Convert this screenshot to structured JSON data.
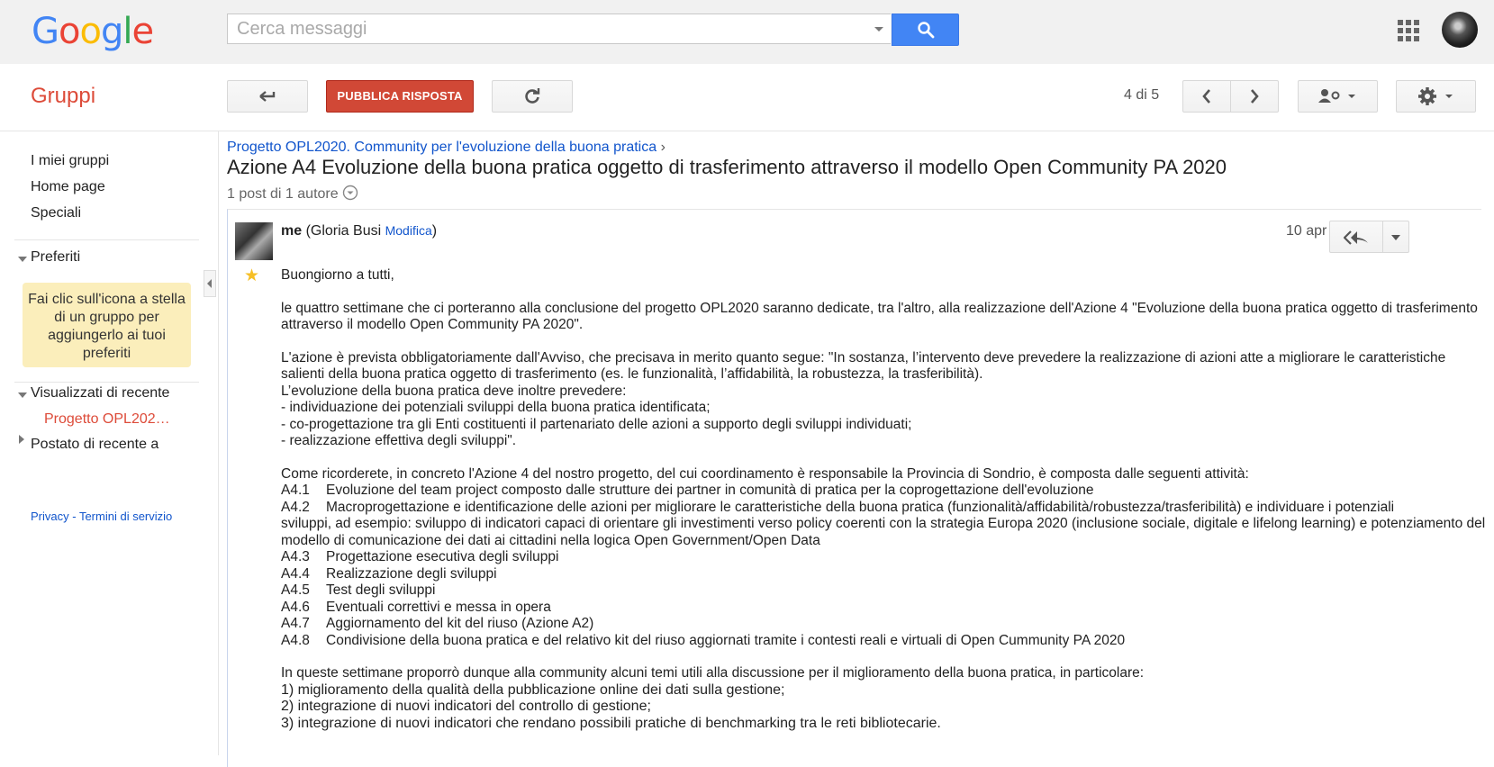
{
  "header": {
    "logo": {
      "letters": [
        "G",
        "o",
        "o",
        "g",
        "l",
        "e"
      ],
      "colors": [
        "#4285f4",
        "#ea4335",
        "#fbbc05",
        "#4285f4",
        "#34a853",
        "#ea4335"
      ]
    },
    "search": {
      "placeholder": "Cerca messaggi",
      "value": ""
    },
    "icons": {
      "search": "search-icon",
      "apps": "apps-grid-icon",
      "account": "account-avatar"
    }
  },
  "toolbar": {
    "app_name": "Gruppi",
    "back_icon": "back-arrow-icon",
    "publish_label": "PUBBLICA RISPOSTA",
    "refresh_icon": "refresh-icon",
    "position": "4 di 5",
    "prev_icon": "chevron-left-icon",
    "next_icon": "chevron-right-icon",
    "members_icon": "manage-members-icon",
    "settings_icon": "gear-icon",
    "accent_color": "#d14836"
  },
  "sidebar": {
    "links": [
      "I miei gruppi",
      "Home page",
      "Speciali"
    ],
    "favorites_label": "Preferiti",
    "favorites_hint": "Fai clic sull'icona a stella di un gruppo per aggiungerlo ai tuoi preferiti",
    "recent_label": "Visualizzati di recente",
    "recent_item": "Progetto OPL202…",
    "posted_label": "Postato di recente a",
    "footer_privacy": "Privacy",
    "footer_sep": " - ",
    "footer_terms": "Termini di servizio"
  },
  "thread": {
    "breadcrumb": "Progetto OPL2020. Community per l'evoluzione della buona pratica",
    "breadcrumb_sep": "›",
    "title": "Azione A4 Evoluzione della buona pratica oggetto di trasferimento attraverso il modello Open Community PA 2020",
    "meta": "1 post di 1 autore"
  },
  "post": {
    "author_me": "me",
    "author_name_open": " (Gloria Busi ",
    "edit_label": "Modifica",
    "author_close": ")",
    "date": "10 apr",
    "greeting": "Buongiorno a tutti,",
    "p1": "le quattro settimane che ci porteranno alla conclusione del progetto OPL2020 saranno dedicate, tra l'altro, alla realizzazione dell'Azione 4 \"Evoluzione della buona pratica oggetto di trasferimento attraverso il modello Open Community PA 2020\".",
    "p2": "L'azione è prevista obbligatoriamente dall'Avviso, che precisava in merito quanto segue: \"In sostanza, l’intervento deve prevedere la realizzazione di azioni atte a migliorare le caratteristiche salienti della buona pratica oggetto di trasferimento (es. le funzionalità, l’affidabilità, la robustezza, la trasferibilità).",
    "p2_lines": [
      "L’evoluzione della buona pratica deve inoltre prevedere:",
      "- individuazione dei potenziali sviluppi della buona pratica identificata;",
      "- co-progettazione tra gli Enti costituenti il partenariato delle azioni a supporto degli sviluppi individuati;",
      "- realizzazione effettiva degli sviluppi\"."
    ],
    "p3_intro": "Come ricorderete, in concreto l'Azione 4 del nostro progetto, del cui coordinamento è responsabile la Provincia di Sondrio, è composta dalle seguenti attività:",
    "activities": [
      {
        "code": "A4.1",
        "text": "Evoluzione del team project composto dalle strutture dei partner in comunità di pratica per la coprogettazione dell'evoluzione"
      },
      {
        "code": "A4.2",
        "text": "Macroprogettazione e identificazione delle azioni per migliorare le caratteristiche della buona pratica (funzionalità/affidabilità/robustezza/trasferibilità) e individuare i potenziali"
      },
      {
        "code": "",
        "text": "sviluppi, ad esempio: sviluppo di indicatori capaci di orientare gli investimenti verso policy coerenti con la strategia Europa 2020 (inclusione sociale, digitale e lifelong learning) e potenziamento del modello di comunicazione dei dati ai cittadini nella logica Open Government/Open Data"
      },
      {
        "code": "A4.3",
        "text": "Progettazione esecutiva degli sviluppi"
      },
      {
        "code": "A4.4",
        "text": "Realizzazione degli sviluppi"
      },
      {
        "code": "A4.5",
        "text": "Test degli sviluppi"
      },
      {
        "code": "A4.6",
        "text": "Eventuali correttivi e messa in opera"
      },
      {
        "code": "A4.7",
        "text": "Aggiornamento del kit del riuso (Azione A2)"
      },
      {
        "code": "A4.8",
        "text": "Condivisione della buona pratica e del relativo kit del riuso aggiornati tramite i contesti reali e virtuali di Open Cummunity PA 2020"
      }
    ],
    "p4_intro": "In queste settimane proporrò dunque alla community alcuni temi utili alla discussione per il miglioramento della buona pratica, in particolare:",
    "topics": [
      "1) miglioramento della qualità della pubblicazione online dei dati sulla gestione;",
      "2) integrazione di nuovi indicatori del controllo di gestione;",
      "3) integrazione di nuovi indicatori che rendano possibili pratiche di benchmarking tra le reti bibliotecarie."
    ],
    "star_color": "#f6bf26"
  }
}
